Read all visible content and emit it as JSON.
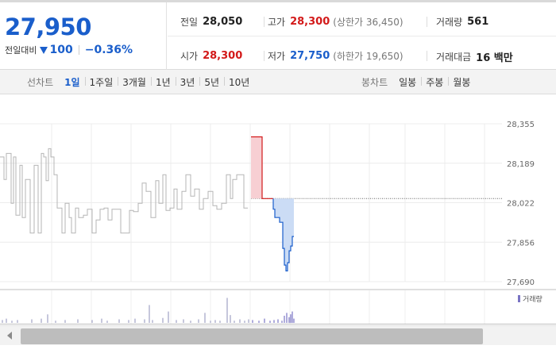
{
  "quote": {
    "price": "27,950",
    "change_label": "전일대비",
    "change_amount": "100",
    "change_percent": "−0.36%"
  },
  "metrics": {
    "prev_label": "전일",
    "prev_value": "28,050",
    "high_label": "고가",
    "high_value": "28,300",
    "upper_limit": "(상한가 36,450)",
    "volume_label": "거래량",
    "volume_value": "561",
    "open_label": "시가",
    "open_value": "28,300",
    "low_label": "저가",
    "low_value": "27,750",
    "lower_limit": "(하한가 19,650)",
    "amount_label": "거래대금",
    "amount_value": "16 백만"
  },
  "toolbar": {
    "line_label": "선차트",
    "periods": [
      "1일",
      "1주일",
      "3개월",
      "1년",
      "3년",
      "5년",
      "10년"
    ],
    "active_period": 0,
    "candle_label": "봉차트",
    "candles": [
      "일봉",
      "주봉",
      "월봉"
    ]
  },
  "colors": {
    "up": "#d31a1a",
    "down": "#1a5ecb",
    "up_fill": "#f7cfd3",
    "down_fill": "#cbdcf5",
    "history_line": "#b5b5b5",
    "volume": "#8d8fb8",
    "volume_today": "#7a74c4"
  },
  "chart_data": {
    "type": "line",
    "y_ticks": [
      "28,355",
      "28,189",
      "28,022",
      "27,856",
      "27,690"
    ],
    "ylim": [
      27690,
      28355
    ],
    "grid": true,
    "baseline_value": 28040,
    "legend": "거래량",
    "history_series": {
      "x": [
        0,
        5,
        5,
        8,
        8,
        14,
        14,
        17,
        17,
        20,
        20,
        25,
        25,
        28,
        28,
        32,
        32,
        38,
        38,
        43,
        43,
        48,
        48,
        52,
        52,
        55,
        55,
        58,
        58,
        61,
        61,
        64,
        64,
        68,
        68,
        72,
        72,
        78,
        78,
        82,
        82,
        87,
        87,
        90,
        90,
        95,
        95,
        99,
        99,
        105,
        105,
        110,
        110,
        116,
        116,
        121,
        121,
        126,
        126,
        131,
        131,
        136,
        136,
        141,
        141,
        147,
        147,
        152,
        152,
        158,
        158,
        163,
        163,
        168,
        168,
        174,
        174,
        179,
        179,
        184,
        184,
        190,
        190,
        196,
        196,
        200,
        200,
        205,
        205,
        209,
        209,
        214,
        214,
        219,
        219,
        223,
        223,
        229,
        229,
        234,
        234,
        240,
        240,
        245,
        245,
        251,
        251,
        256,
        256,
        262,
        262,
        268,
        268,
        273,
        273,
        279,
        279,
        285,
        285,
        290,
        290,
        293,
        293,
        298,
        298,
        303,
        303,
        307,
        307,
        312
      ],
      "y": [
        28215,
        28215,
        28120,
        28120,
        28230,
        28230,
        28020,
        28020,
        28215,
        28215,
        27970,
        27970,
        28180,
        28180,
        27960,
        27960,
        28120,
        28120,
        27895,
        27895,
        28180,
        28180,
        27895,
        27895,
        28230,
        28230,
        28215,
        28215,
        28115,
        28115,
        28250,
        28250,
        28215,
        28215,
        28140,
        28140,
        28000,
        28000,
        27895,
        27895,
        28020,
        28020,
        27960,
        27960,
        27895,
        27895,
        28000,
        28000,
        27960,
        27960,
        27970,
        27970,
        27995,
        27995,
        27895,
        27895,
        27950,
        27950,
        27995,
        27995,
        28000,
        28000,
        27950,
        27950,
        27995,
        27995,
        27995,
        27995,
        27895,
        27895,
        27895,
        27895,
        27990,
        27990,
        27985,
        27985,
        28020,
        28020,
        28105,
        28105,
        28070,
        28070,
        27960,
        27960,
        28115,
        28115,
        28020,
        28020,
        28140,
        28140,
        27990,
        27990,
        28000,
        28000,
        28080,
        28080,
        27995,
        27995,
        28070,
        28070,
        28140,
        28140,
        28050,
        28050,
        28080,
        28080,
        27995,
        27995,
        28040,
        28040,
        28070,
        28070,
        28010,
        28010,
        27995,
        27995,
        28020,
        28020,
        28140,
        28140,
        28040,
        28040,
        28120,
        28120,
        28140,
        28140,
        28140,
        28140,
        28000,
        28000
      ]
    },
    "today_series": {
      "x": [
        316,
        330,
        330,
        340,
        340,
        344,
        344,
        346,
        346,
        352,
        352,
        356,
        356,
        358,
        358,
        360,
        360,
        362,
        362,
        364,
        364,
        366,
        366,
        368,
        368,
        370
      ],
      "y": [
        28300,
        28300,
        28040,
        28040,
        28040,
        28040,
        27995,
        27995,
        27960,
        27960,
        27940,
        27940,
        27830,
        27830,
        27760,
        27760,
        27735,
        27735,
        27770,
        27770,
        27820,
        27820,
        27840,
        27840,
        27880,
        27880
      ]
    },
    "volume_bars": [
      {
        "x": 3,
        "v": 4
      },
      {
        "x": 8,
        "v": 6
      },
      {
        "x": 15,
        "v": 3
      },
      {
        "x": 22,
        "v": 4
      },
      {
        "x": 40,
        "v": 5
      },
      {
        "x": 52,
        "v": 6
      },
      {
        "x": 60,
        "v": 12
      },
      {
        "x": 70,
        "v": 3
      },
      {
        "x": 82,
        "v": 4
      },
      {
        "x": 98,
        "v": 5
      },
      {
        "x": 116,
        "v": 4
      },
      {
        "x": 128,
        "v": 6
      },
      {
        "x": 135,
        "v": 3
      },
      {
        "x": 150,
        "v": 5
      },
      {
        "x": 162,
        "v": 4
      },
      {
        "x": 170,
        "v": 6
      },
      {
        "x": 182,
        "v": 5
      },
      {
        "x": 188,
        "v": 25
      },
      {
        "x": 192,
        "v": 4
      },
      {
        "x": 205,
        "v": 7
      },
      {
        "x": 212,
        "v": 16
      },
      {
        "x": 222,
        "v": 4
      },
      {
        "x": 231,
        "v": 5
      },
      {
        "x": 240,
        "v": 3
      },
      {
        "x": 250,
        "v": 5
      },
      {
        "x": 258,
        "v": 14
      },
      {
        "x": 265,
        "v": 3
      },
      {
        "x": 271,
        "v": 4
      },
      {
        "x": 277,
        "v": 3
      },
      {
        "x": 286,
        "v": 35
      },
      {
        "x": 290,
        "v": 11
      },
      {
        "x": 295,
        "v": 3
      },
      {
        "x": 302,
        "v": 5
      },
      {
        "x": 308,
        "v": 3
      },
      {
        "x": 313,
        "v": 5
      }
    ],
    "volume_today_bars": [
      {
        "x": 318,
        "v": 4
      },
      {
        "x": 326,
        "v": 3
      },
      {
        "x": 333,
        "v": 6
      },
      {
        "x": 340,
        "v": 3
      },
      {
        "x": 345,
        "v": 4
      },
      {
        "x": 350,
        "v": 5
      },
      {
        "x": 355,
        "v": 3
      },
      {
        "x": 358,
        "v": 10
      },
      {
        "x": 361,
        "v": 14
      },
      {
        "x": 364,
        "v": 8
      },
      {
        "x": 366,
        "v": 12
      },
      {
        "x": 368,
        "v": 16
      },
      {
        "x": 370,
        "v": 6
      }
    ],
    "volume_max": 40
  }
}
